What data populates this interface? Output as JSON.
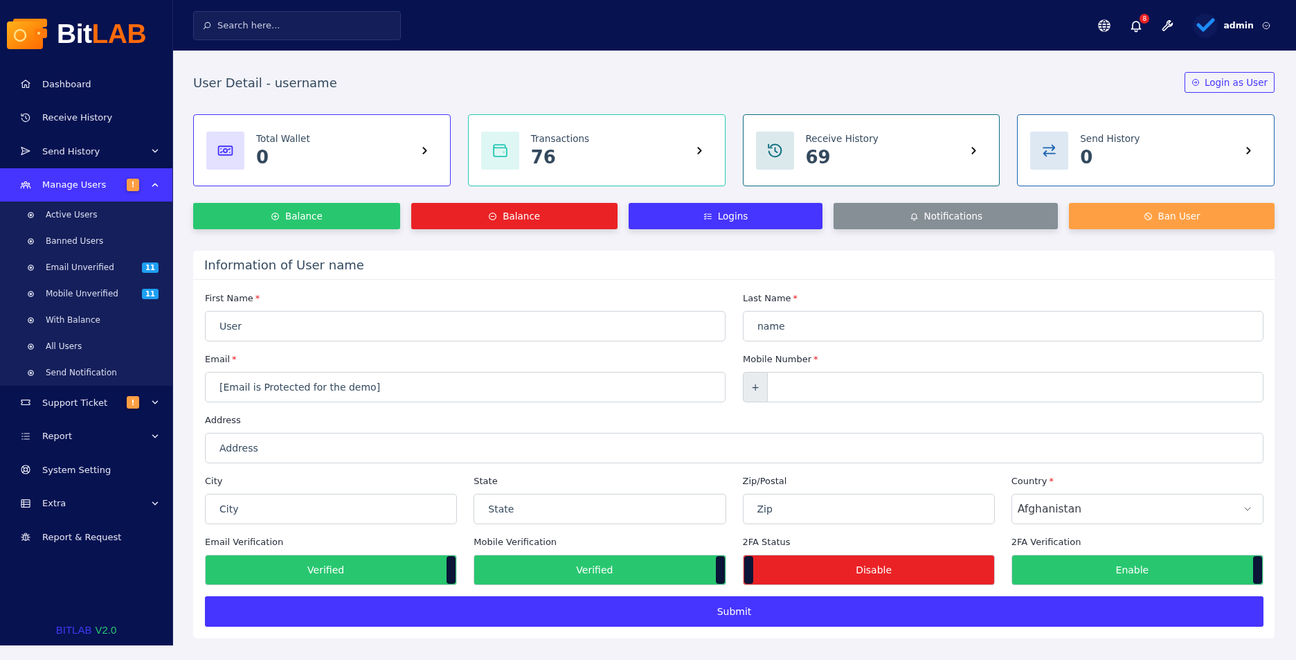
{
  "sidebar": {
    "logo": {
      "part_1": "Bit",
      "part_2": "LAB"
    },
    "items": [
      {
        "kind": "link",
        "label": "Dashboard",
        "selected": false
      },
      {
        "kind": "link",
        "label": "Receive History",
        "selected": false
      },
      {
        "kind": "dropdown",
        "label": "Send History",
        "selected": false,
        "expanded": false
      },
      {
        "kind": "dropdown",
        "label": "Manage Users",
        "selected": true,
        "expanded": true,
        "badge": "!",
        "children": [
          {
            "label": "Active Users",
            "selected": false
          },
          {
            "label": "Banned Users",
            "selected": false
          },
          {
            "label": "Email Unverified",
            "selected": false,
            "badge": "11"
          },
          {
            "label": "Mobile Unverified",
            "selected": false,
            "badge": "11"
          },
          {
            "label": "With Balance",
            "selected": false
          },
          {
            "label": "All Users",
            "selected": false
          },
          {
            "label": "Send Notification",
            "selected": false
          }
        ]
      },
      {
        "kind": "dropdown",
        "label": "Support Ticket",
        "selected": false,
        "expanded": false,
        "badge": "!"
      },
      {
        "kind": "dropdown",
        "label": "Report",
        "selected": false,
        "expanded": false
      },
      {
        "kind": "link",
        "label": "System Setting",
        "selected": false
      },
      {
        "kind": "dropdown",
        "label": "Extra",
        "selected": false,
        "expanded": false
      },
      {
        "kind": "link",
        "label": "Report & Request",
        "selected": false
      }
    ],
    "version": {
      "name": "BITLAB",
      "number": "V2.0"
    }
  },
  "header": {
    "search": {
      "placeholder": "Search here..."
    },
    "notification_count": "8",
    "user": "admin"
  },
  "page": {
    "title": "User Detail - username",
    "login_button": "Login as User"
  },
  "stats": [
    {
      "label": "Total Wallet",
      "value": "0",
      "color": "#4634ff"
    },
    {
      "label": "Transactions",
      "value": "76",
      "color": "#28c8b4"
    },
    {
      "label": "Receive History",
      "value": "69",
      "color": "#0e6e80"
    },
    {
      "label": "Send History",
      "value": "0",
      "color": "#1e63b0"
    }
  ],
  "actions": [
    {
      "label": "Balance",
      "color": "#28c76f"
    },
    {
      "label": "Balance",
      "color": "#ea2225"
    },
    {
      "label": "Logins",
      "color": "#4634ff"
    },
    {
      "label": "Notifications",
      "color": "#868e96"
    },
    {
      "label": "Ban User",
      "color": "#ff9f43"
    }
  ],
  "info": {
    "title": "Information of User name",
    "rows": [
      {
        "fields": [
          {
            "kind": "text",
            "label": "First Name",
            "marker": "*",
            "value": "User"
          },
          {
            "kind": "text",
            "label": "Last Name",
            "marker": "*",
            "value": "name"
          }
        ]
      },
      {
        "fields": [
          {
            "kind": "text",
            "label": "Email",
            "marker": "*",
            "value": "[Email is Protected for the demo]"
          },
          {
            "kind": "phone",
            "label": "Mobile Number",
            "marker": "*",
            "prefix": "+"
          }
        ]
      },
      {
        "fields": [
          {
            "kind": "text",
            "label": "Address",
            "value": "Address"
          }
        ]
      },
      {
        "fields": [
          {
            "kind": "text",
            "label": "City",
            "value": "City"
          },
          {
            "kind": "text",
            "label": "State",
            "value": "State"
          },
          {
            "kind": "text",
            "label": "Zip/Postal",
            "value": "Zip"
          },
          {
            "kind": "select",
            "label": "Country",
            "marker": "*",
            "value": "Afghanistan"
          }
        ]
      },
      {
        "fields": [
          {
            "kind": "toggle",
            "label": "Email Verification",
            "value": "Verified",
            "on": true
          },
          {
            "kind": "toggle",
            "label": "Mobile Verification",
            "value": "Verified",
            "on": true
          },
          {
            "kind": "toggle",
            "label": "2FA Status",
            "value": "Disable",
            "on": false
          },
          {
            "kind": "toggle",
            "label": "2FA Verification",
            "value": "Enable",
            "on": true
          }
        ]
      }
    ],
    "submit": "Submit"
  }
}
